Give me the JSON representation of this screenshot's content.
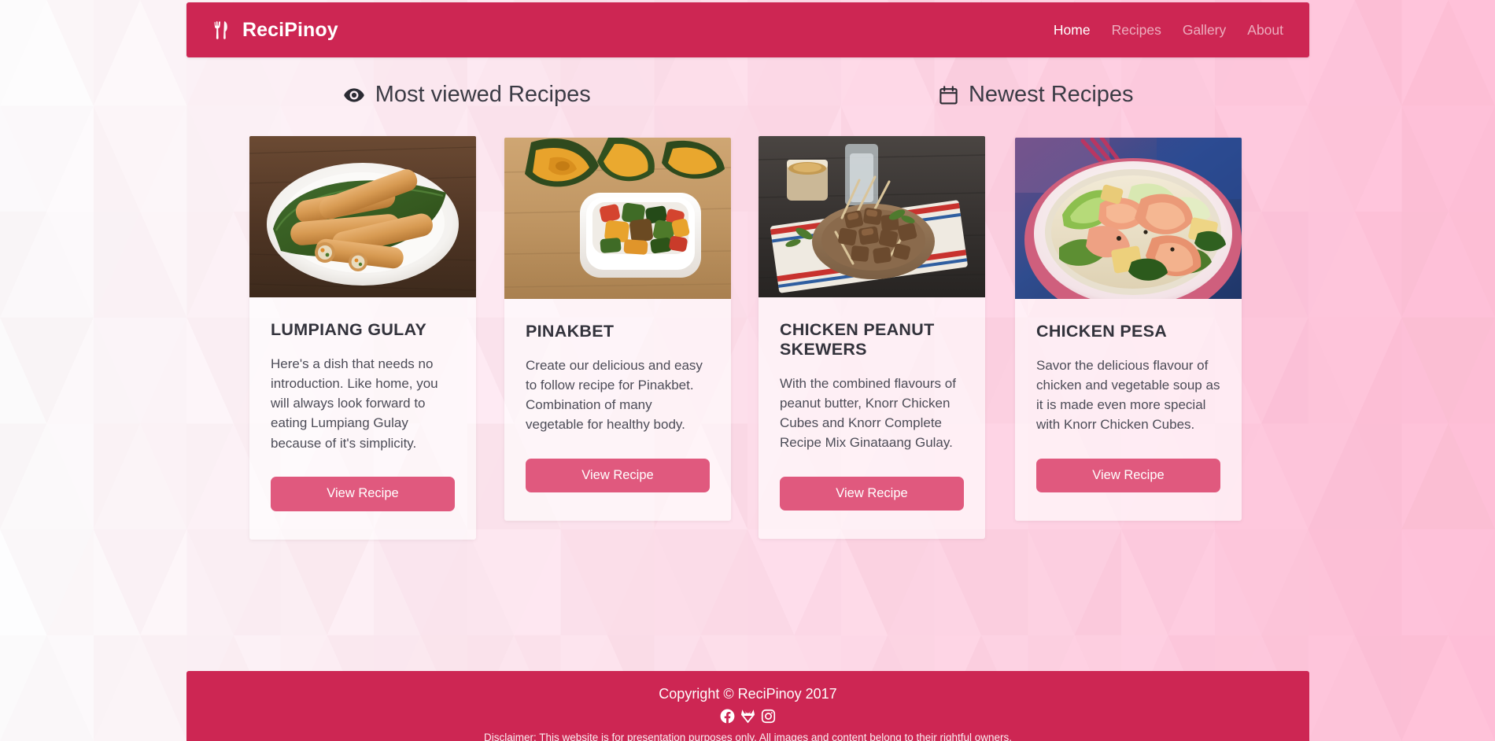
{
  "site": {
    "brand": "ReciPinoy",
    "brand_icon": "fork-knife-icon",
    "accent_color": "#cd2653",
    "button_color": "#e0597e",
    "card_bg": "rgba(255,255,255,0.62)"
  },
  "nav": {
    "items": [
      {
        "label": "Home",
        "active": true
      },
      {
        "label": "Recipes",
        "active": false
      },
      {
        "label": "Gallery",
        "active": false
      },
      {
        "label": "About",
        "active": false
      }
    ]
  },
  "sections": [
    {
      "id": "most-viewed",
      "title": "Most viewed Recipes",
      "icon": "eye-icon"
    },
    {
      "id": "newest",
      "title": "Newest Recipes",
      "icon": "calendar-icon"
    }
  ],
  "cards": [
    {
      "title": "LUMPIANG GULAY",
      "text": "Here's a dish that needs no introduction. Like home, you will always look forward to eating Lumpiang Gulay because of it's simplicity.",
      "button": "View Recipe",
      "image_alt": "lumpiang-gulay-spring-rolls-on-banana-leaf"
    },
    {
      "title": "PINAKBET",
      "text": "Create our delicious and easy to follow recipe for Pinakbet. Combination of many vegetable for healthy body.",
      "button": "View Recipe",
      "image_alt": "pinakbet-vegetable-dish-in-white-bowl"
    },
    {
      "title": "CHICKEN PEANUT SKEWERS",
      "text": "With the combined flavours of peanut butter, Knorr Chicken Cubes and Knorr Complete Recipe Mix Ginataang Gulay.",
      "button": "View Recipe",
      "image_alt": "chicken-peanut-skewers-on-wooden-plate"
    },
    {
      "title": "CHICKEN PESA",
      "text": "Savor the delicious flavour of chicken and vegetable soup as it is made even more special with Knorr Chicken Cubes.",
      "button": "View Recipe",
      "image_alt": "chicken-pesa-soup-in-bowl"
    }
  ],
  "footer": {
    "copyright": "Copyright © ReciPinoy 2017",
    "disclaimer": "Disclaimer: This website is for presentation purposes only. All images and content belong to their rightful owners.",
    "social": [
      {
        "name": "facebook-icon"
      },
      {
        "name": "fox-icon"
      },
      {
        "name": "instagram-icon"
      }
    ]
  }
}
